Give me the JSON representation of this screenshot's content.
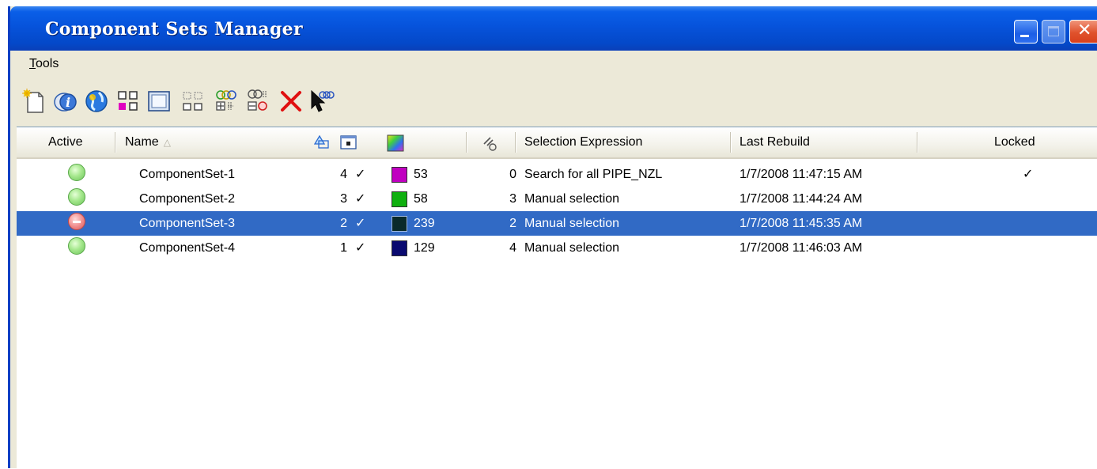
{
  "window": {
    "title": "Component Sets Manager"
  },
  "menu": {
    "tools_label_underlined": "T",
    "tools_label_rest": "ools"
  },
  "toolbar": {
    "buttons": [
      {
        "icon": "new-set-icon"
      },
      {
        "icon": "properties-icon"
      },
      {
        "icon": "globe-icon"
      },
      {
        "icon": "select-all-colors-icon"
      },
      {
        "icon": "window-icon"
      },
      {
        "icon": "grid-outline-icon"
      },
      {
        "icon": "union-sets-icon"
      },
      {
        "icon": "subtract-sets-icon"
      },
      {
        "icon": "delete-icon"
      },
      {
        "icon": "pick-in-view-icon"
      }
    ]
  },
  "columns": {
    "active": "Active",
    "name": "Name",
    "selection_expression": "Selection Expression",
    "last_rebuild": "Last Rebuild",
    "locked": "Locked"
  },
  "rows": [
    {
      "status": "ok",
      "name": "ComponentSet-1",
      "count": "4",
      "visible": "✓",
      "color": "#c000c0",
      "color_index": "53",
      "links": "0",
      "selection": "Search for all PIPE_NZL",
      "last_rebuild": "1/7/2008 11:47:15 AM",
      "locked": "✓"
    },
    {
      "status": "ok",
      "name": "ComponentSet-2",
      "count": "3",
      "visible": "✓",
      "color": "#10b010",
      "color_index": "58",
      "links": "3",
      "selection": "Manual selection",
      "last_rebuild": "1/7/2008 11:44:24 AM",
      "locked": ""
    },
    {
      "status": "err",
      "name": "ComponentSet-3",
      "count": "2",
      "visible": "✓",
      "color": "#0a2a2a",
      "color_index": "239",
      "links": "2",
      "selection": "Manual selection",
      "last_rebuild": "1/7/2008 11:45:35 AM",
      "locked": "",
      "selected": true
    },
    {
      "status": "ok",
      "name": "ComponentSet-4",
      "count": "1",
      "visible": "✓",
      "color": "#0a0a70",
      "color_index": "129",
      "links": "4",
      "selection": "Manual selection",
      "last_rebuild": "1/7/2008 11:46:03 AM",
      "locked": ""
    }
  ],
  "colors": {
    "titlebar": "#0653db",
    "selection": "#316ac5",
    "chrome": "#ece9d8"
  }
}
